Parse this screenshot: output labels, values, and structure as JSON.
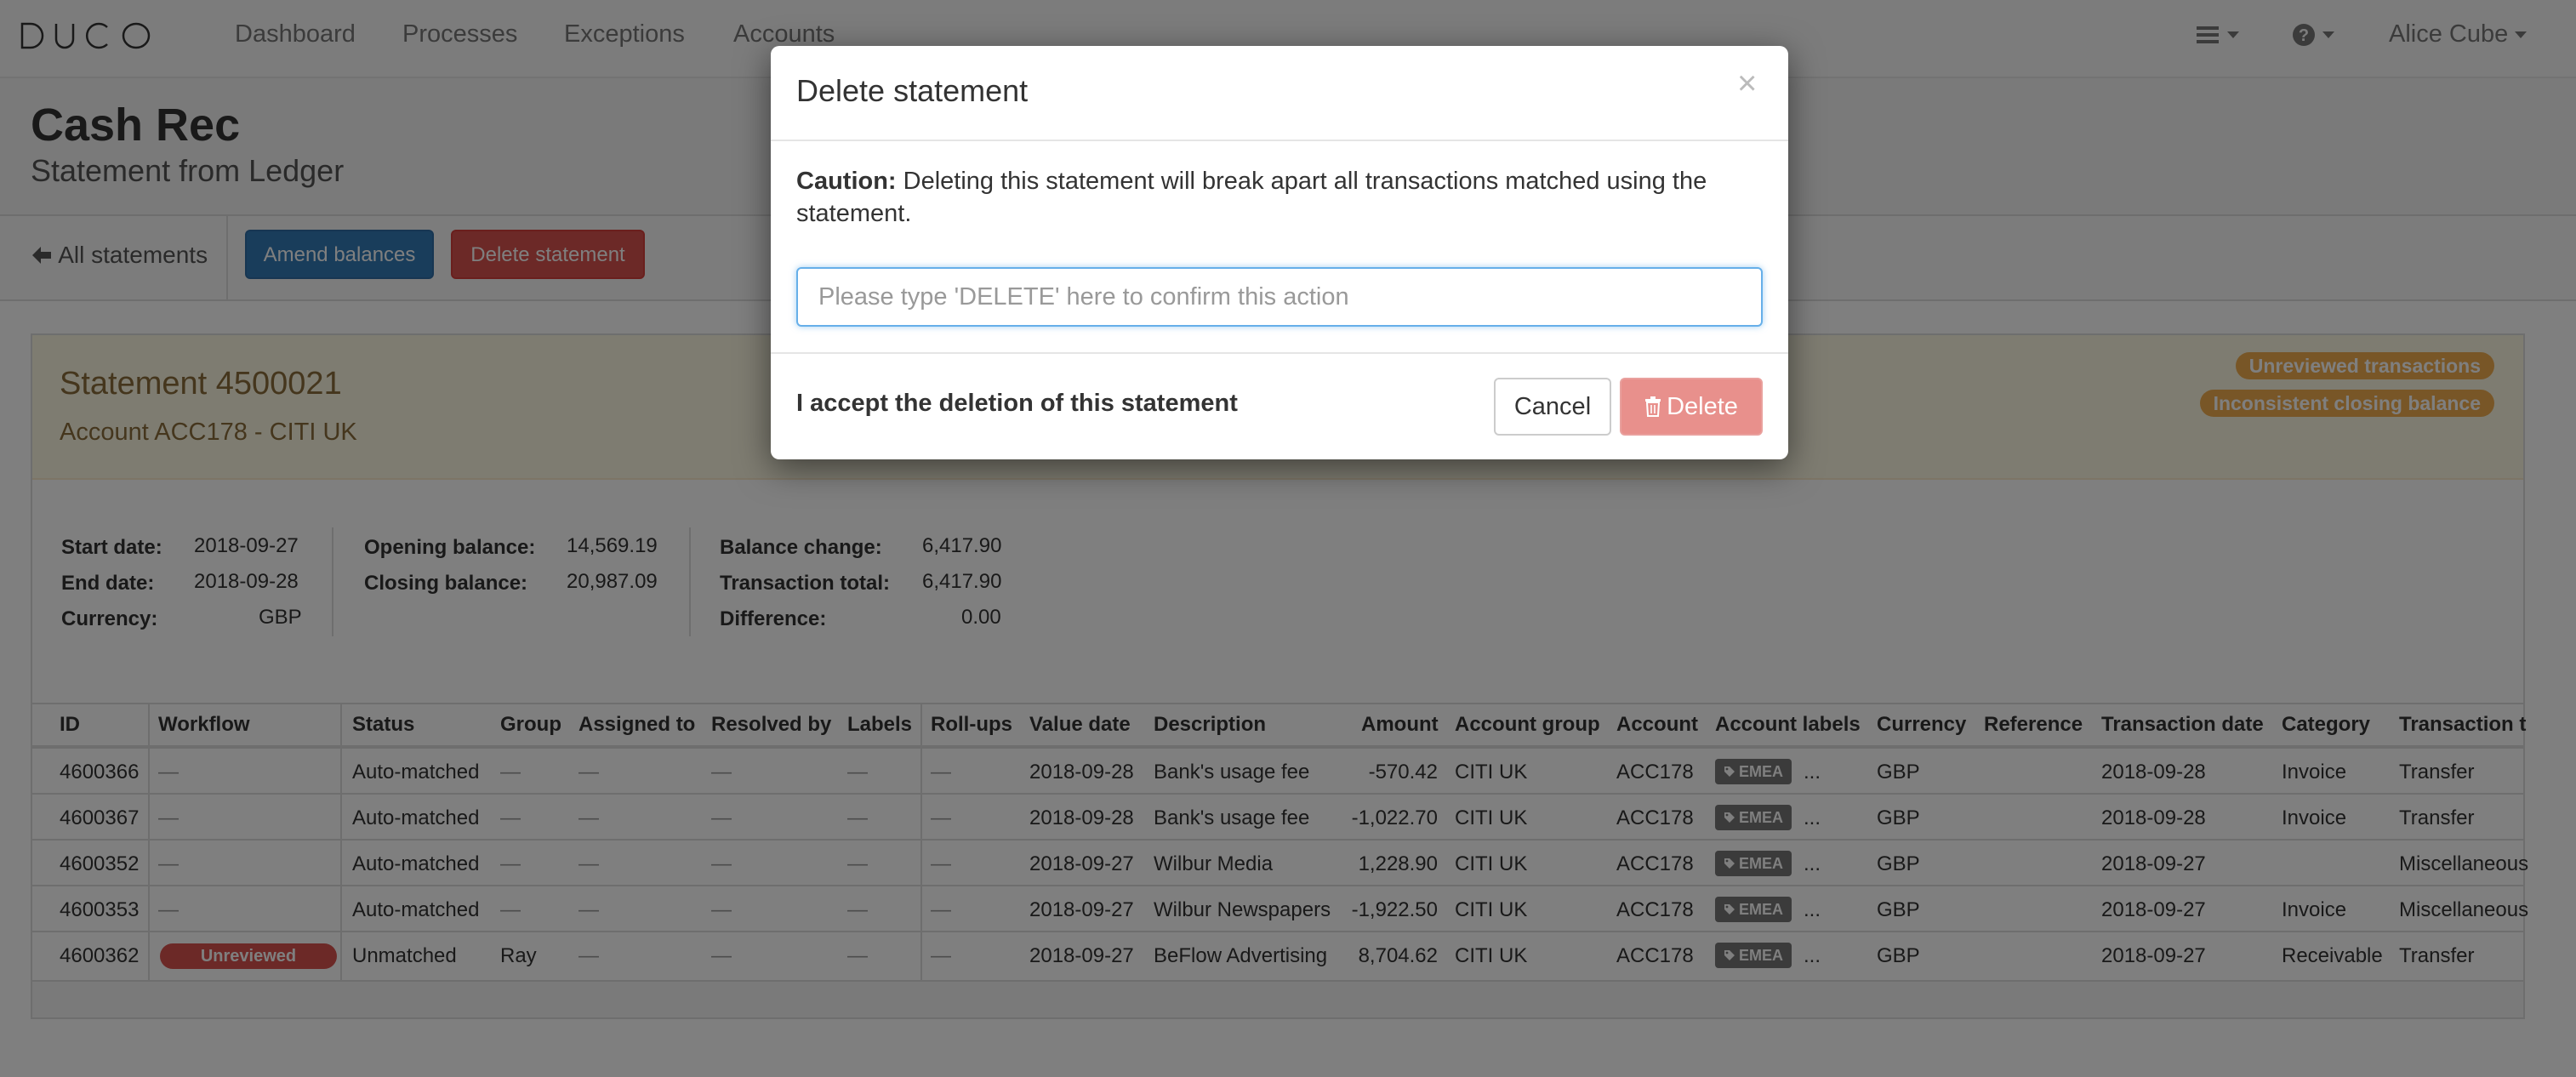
{
  "nav": {
    "logo": "DUCO",
    "links": [
      "Dashboard",
      "Processes",
      "Exceptions",
      "Accounts"
    ],
    "user": "Alice Cube"
  },
  "header": {
    "title": "Cash Rec",
    "subtitle": "Statement from Ledger"
  },
  "toolbar": {
    "back_label": "All statements",
    "amend_label": "Amend balances",
    "delete_label": "Delete statement"
  },
  "statement": {
    "title": "Statement 4500021",
    "account": "Account ACC178 - CITI UK",
    "badges": [
      "Unreviewed transactions",
      "Inconsistent closing balance"
    ],
    "summary": {
      "start_label": "Start date:",
      "start": "2018-09-27",
      "end_label": "End date:",
      "end": "2018-09-28",
      "currency_label": "Currency:",
      "currency": "GBP",
      "opening_label": "Opening balance:",
      "opening": "14,569.19",
      "closing_label": "Closing balance:",
      "closing": "20,987.09",
      "change_label": "Balance change:",
      "change": "6,417.90",
      "txtotal_label": "Transaction total:",
      "txtotal": "6,417.90",
      "diff_label": "Difference:",
      "diff": "0.00"
    }
  },
  "table": {
    "columns": [
      "ID",
      "Workflow",
      "Status",
      "Group",
      "Assigned to",
      "Resolved by",
      "Labels",
      "Roll-ups",
      "Value date",
      "Description",
      "Amount",
      "Account group",
      "Account",
      "Account labels",
      "Currency",
      "Reference",
      "Transaction date",
      "Category",
      "Transaction t"
    ],
    "rows": [
      {
        "id": "4600366",
        "workflow": "—",
        "status": "Auto-matched",
        "group": "—",
        "assigned": "—",
        "resolved": "—",
        "labels": "—",
        "rollups": "—",
        "value_date": "2018-09-28",
        "description": "Bank's usage fee",
        "amount": "-570.42",
        "account_group": "CITI UK",
        "account": "ACC178",
        "account_label": "EMEA",
        "more": "...",
        "currency": "GBP",
        "reference": "",
        "tx_date": "2018-09-28",
        "category": "Invoice",
        "tx_type": "Transfer"
      },
      {
        "id": "4600367",
        "workflow": "—",
        "status": "Auto-matched",
        "group": "—",
        "assigned": "—",
        "resolved": "—",
        "labels": "—",
        "rollups": "—",
        "value_date": "2018-09-28",
        "description": "Bank's usage fee",
        "amount": "-1,022.70",
        "account_group": "CITI UK",
        "account": "ACC178",
        "account_label": "EMEA",
        "more": "...",
        "currency": "GBP",
        "reference": "",
        "tx_date": "2018-09-28",
        "category": "Invoice",
        "tx_type": "Transfer"
      },
      {
        "id": "4600352",
        "workflow": "—",
        "status": "Auto-matched",
        "group": "—",
        "assigned": "—",
        "resolved": "—",
        "labels": "—",
        "rollups": "—",
        "value_date": "2018-09-27",
        "description": "Wilbur Media",
        "amount": "1,228.90",
        "account_group": "CITI UK",
        "account": "ACC178",
        "account_label": "EMEA",
        "more": "...",
        "currency": "GBP",
        "reference": "",
        "tx_date": "2018-09-27",
        "category": "",
        "tx_type": "Miscellaneous"
      },
      {
        "id": "4600353",
        "workflow": "—",
        "status": "Auto-matched",
        "group": "—",
        "assigned": "—",
        "resolved": "—",
        "labels": "—",
        "rollups": "—",
        "value_date": "2018-09-27",
        "description": "Wilbur Newspapers",
        "amount": "-1,922.50",
        "account_group": "CITI UK",
        "account": "ACC178",
        "account_label": "EMEA",
        "more": "...",
        "currency": "GBP",
        "reference": "",
        "tx_date": "2018-09-27",
        "category": "Invoice",
        "tx_type": "Miscellaneous"
      },
      {
        "id": "4600362",
        "workflow": "Unreviewed",
        "status": "Unmatched",
        "group": "Ray",
        "assigned": "—",
        "resolved": "—",
        "labels": "—",
        "rollups": "—",
        "value_date": "2018-09-27",
        "description": "BeFlow Advertising",
        "amount": "8,704.62",
        "account_group": "CITI UK",
        "account": "ACC178",
        "account_label": "EMEA",
        "more": "...",
        "currency": "GBP",
        "reference": "",
        "tx_date": "2018-09-27",
        "category": "Receivable",
        "tx_type": "Transfer"
      }
    ]
  },
  "modal": {
    "title": "Delete statement",
    "close": "×",
    "caution_label": "Caution:",
    "caution_text": " Deleting this statement will break apart all transactions matched using the statement.",
    "input_placeholder": "Please type 'DELETE' here to confirm this action",
    "input_value": "",
    "accept_label": "I accept the deletion of this statement",
    "cancel_label": "Cancel",
    "delete_label": "Delete"
  },
  "colors": {
    "primary": "#337ab7",
    "danger": "#d9534f",
    "warning": "#f0ad4e",
    "warning_bg": "#fcf8e3",
    "warning_text": "#8a6d3b"
  },
  "icons": {
    "menu": "hamburger-icon",
    "help": "question-circle-icon",
    "back": "arrow-left-icon",
    "tag": "tag-icon",
    "trash": "trash-icon"
  }
}
